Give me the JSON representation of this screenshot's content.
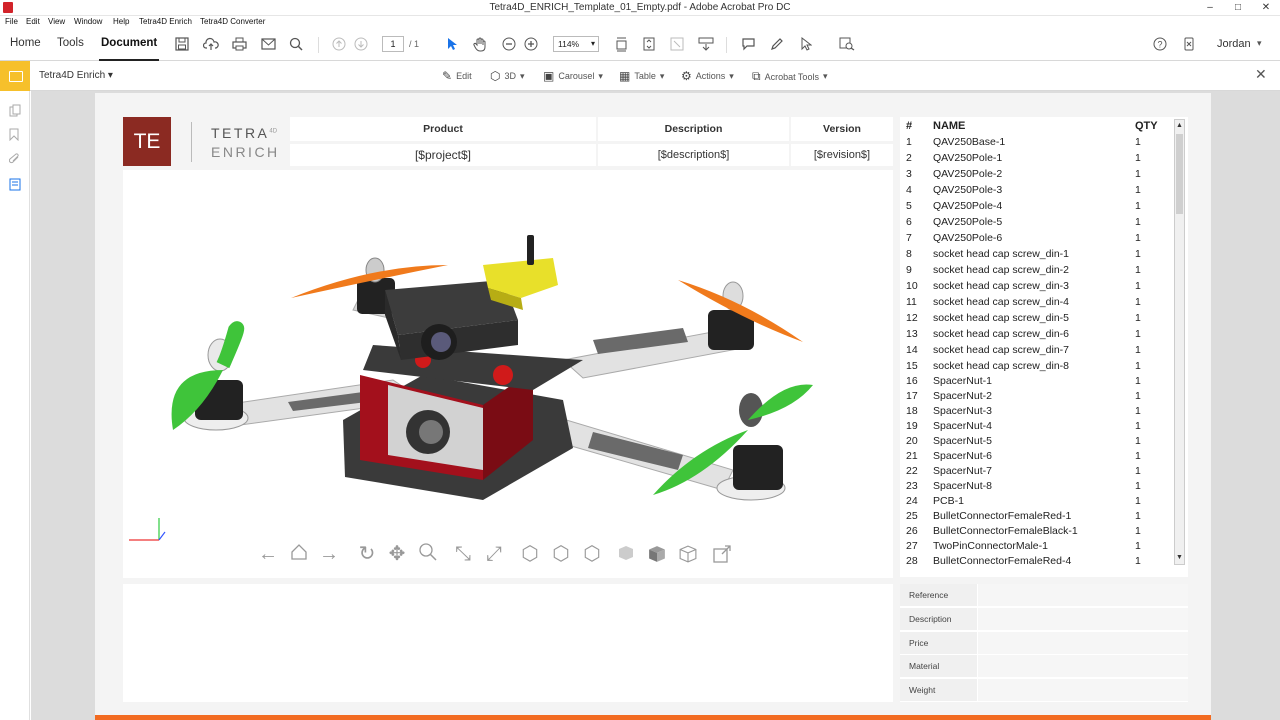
{
  "window": {
    "title": "Tetra4D_ENRICH_Template_01_Empty.pdf - Adobe Acrobat Pro DC",
    "controls": [
      "–",
      "□",
      "✕"
    ]
  },
  "menu": [
    "File",
    "Edit",
    "View",
    "Window",
    "Help",
    "Tetra4D Enrich",
    "Tetra4D Converter"
  ],
  "toolbar": {
    "tabs": [
      "Home",
      "Tools",
      "Document"
    ],
    "active_tab": "Document",
    "page_current": "1",
    "page_total": "/ 1",
    "zoom": "114%",
    "user": "Jordan"
  },
  "enrich_bar": {
    "title": "Tetra4D Enrich",
    "tools": [
      "Edit",
      "3D",
      "Carousel",
      "Table",
      "Actions",
      "Acrobat Tools"
    ]
  },
  "logo": {
    "mark": "TE",
    "line1": "TETRA",
    "sup": "4D",
    "line2": "ENRICH"
  },
  "header": {
    "labels": [
      "Product",
      "Description",
      "Version"
    ],
    "values": [
      "[$project$]",
      "[$description$]",
      "[$revision$]"
    ]
  },
  "bom": {
    "columns": [
      "#",
      "NAME",
      "QTY"
    ],
    "rows": [
      [
        "1",
        "QAV250Base-1",
        "1"
      ],
      [
        "2",
        "QAV250Pole-1",
        "1"
      ],
      [
        "3",
        "QAV250Pole-2",
        "1"
      ],
      [
        "4",
        "QAV250Pole-3",
        "1"
      ],
      [
        "5",
        "QAV250Pole-4",
        "1"
      ],
      [
        "6",
        "QAV250Pole-5",
        "1"
      ],
      [
        "7",
        "QAV250Pole-6",
        "1"
      ],
      [
        "8",
        "socket head cap screw_din-1",
        "1"
      ],
      [
        "9",
        "socket head cap screw_din-2",
        "1"
      ],
      [
        "10",
        "socket head cap screw_din-3",
        "1"
      ],
      [
        "11",
        "socket head cap screw_din-4",
        "1"
      ],
      [
        "12",
        "socket head cap screw_din-5",
        "1"
      ],
      [
        "13",
        "socket head cap screw_din-6",
        "1"
      ],
      [
        "14",
        "socket head cap screw_din-7",
        "1"
      ],
      [
        "15",
        "socket head cap screw_din-8",
        "1"
      ],
      [
        "16",
        "SpacerNut-1",
        "1"
      ],
      [
        "17",
        "SpacerNut-2",
        "1"
      ],
      [
        "18",
        "SpacerNut-3",
        "1"
      ],
      [
        "19",
        "SpacerNut-4",
        "1"
      ],
      [
        "20",
        "SpacerNut-5",
        "1"
      ],
      [
        "21",
        "SpacerNut-6",
        "1"
      ],
      [
        "22",
        "SpacerNut-7",
        "1"
      ],
      [
        "23",
        "SpacerNut-8",
        "1"
      ],
      [
        "24",
        "PCB-1",
        "1"
      ],
      [
        "25",
        "BulletConnectorFemaleRed-1",
        "1"
      ],
      [
        "26",
        "BulletConnectorFemaleBlack-1",
        "1"
      ],
      [
        "27",
        "TwoPinConnectorMale-1",
        "1"
      ],
      [
        "28",
        "BulletConnectorFemaleRed-4",
        "1"
      ]
    ]
  },
  "properties": {
    "labels": [
      "Reference",
      "Description",
      "Price",
      "Material",
      "Weight"
    ]
  },
  "colors": {
    "accent_orange": "#f26b21",
    "logo_red": "#8b2a22",
    "enrich_yellow": "#f6c02b",
    "selection_blue": "#1a73e8"
  }
}
